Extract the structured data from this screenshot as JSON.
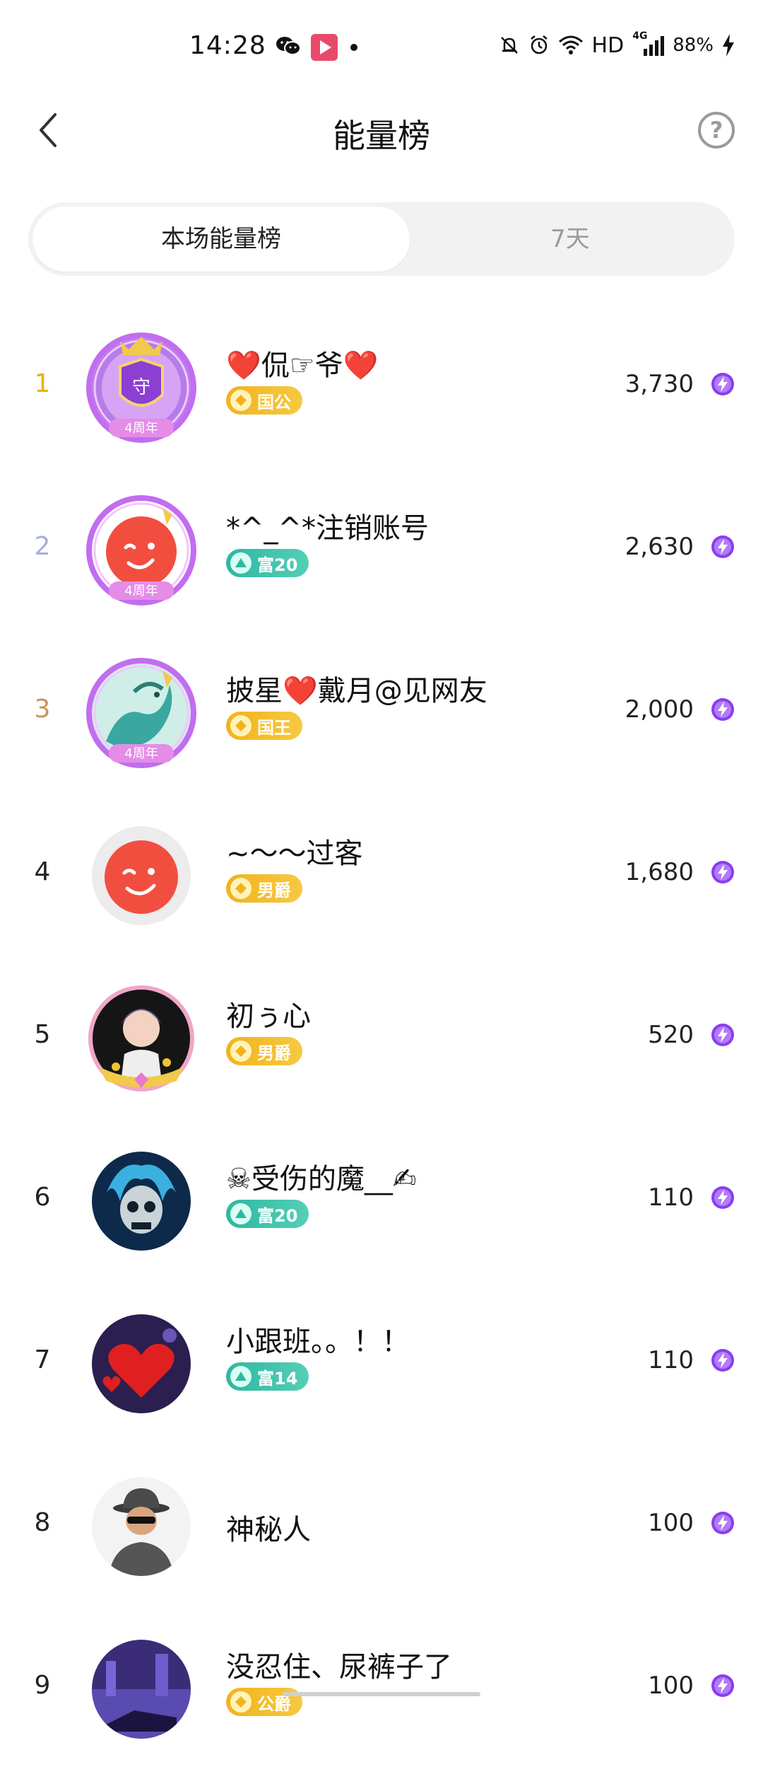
{
  "status_bar": {
    "time": "14:28",
    "network": "HD",
    "signal": "4G",
    "battery": "88%"
  },
  "header": {
    "title": "能量榜",
    "back_icon": "chevron-left-icon",
    "help_label": "?"
  },
  "tabs": [
    {
      "label": "本场能量榜",
      "active": true
    },
    {
      "label": "7天",
      "active": false
    }
  ],
  "ranking": [
    {
      "rank": "1",
      "name": "❤️侃☞爷❤️",
      "badge": "国公",
      "badge_type": "gold",
      "score": "3,730"
    },
    {
      "rank": "2",
      "name": "*^_^*注销账号",
      "badge": "富20",
      "badge_type": "teal",
      "score": "2,630"
    },
    {
      "rank": "3",
      "name": "披星❤️戴月@见网友",
      "badge": "国王",
      "badge_type": "gold",
      "score": "2,000"
    },
    {
      "rank": "4",
      "name": "~〜〜过客",
      "badge": "男爵",
      "badge_type": "gold",
      "score": "1,680"
    },
    {
      "rank": "5",
      "name": "初ぅ心",
      "badge": "男爵",
      "badge_type": "gold",
      "score": "520"
    },
    {
      "rank": "6",
      "name": "☠受伤的魔__✍",
      "badge": "富20",
      "badge_type": "teal",
      "score": "110"
    },
    {
      "rank": "7",
      "name": "小跟班。。！！",
      "badge": "富14",
      "badge_type": "teal",
      "score": "110"
    },
    {
      "rank": "8",
      "name": "神秘人",
      "badge": "",
      "badge_type": "",
      "score": "100"
    },
    {
      "rank": "9",
      "name": "没忍住、尿裤子了",
      "badge": "公爵",
      "badge_type": "gold",
      "score": "100"
    }
  ],
  "colors": {
    "rank_gold": "#e8b10c",
    "rank_silver": "#a6aed8",
    "rank_bronze": "#c99456",
    "badge_gold": "#f3b21d",
    "badge_teal": "#2eb7a1",
    "energy_purple": "#8a3df0"
  }
}
